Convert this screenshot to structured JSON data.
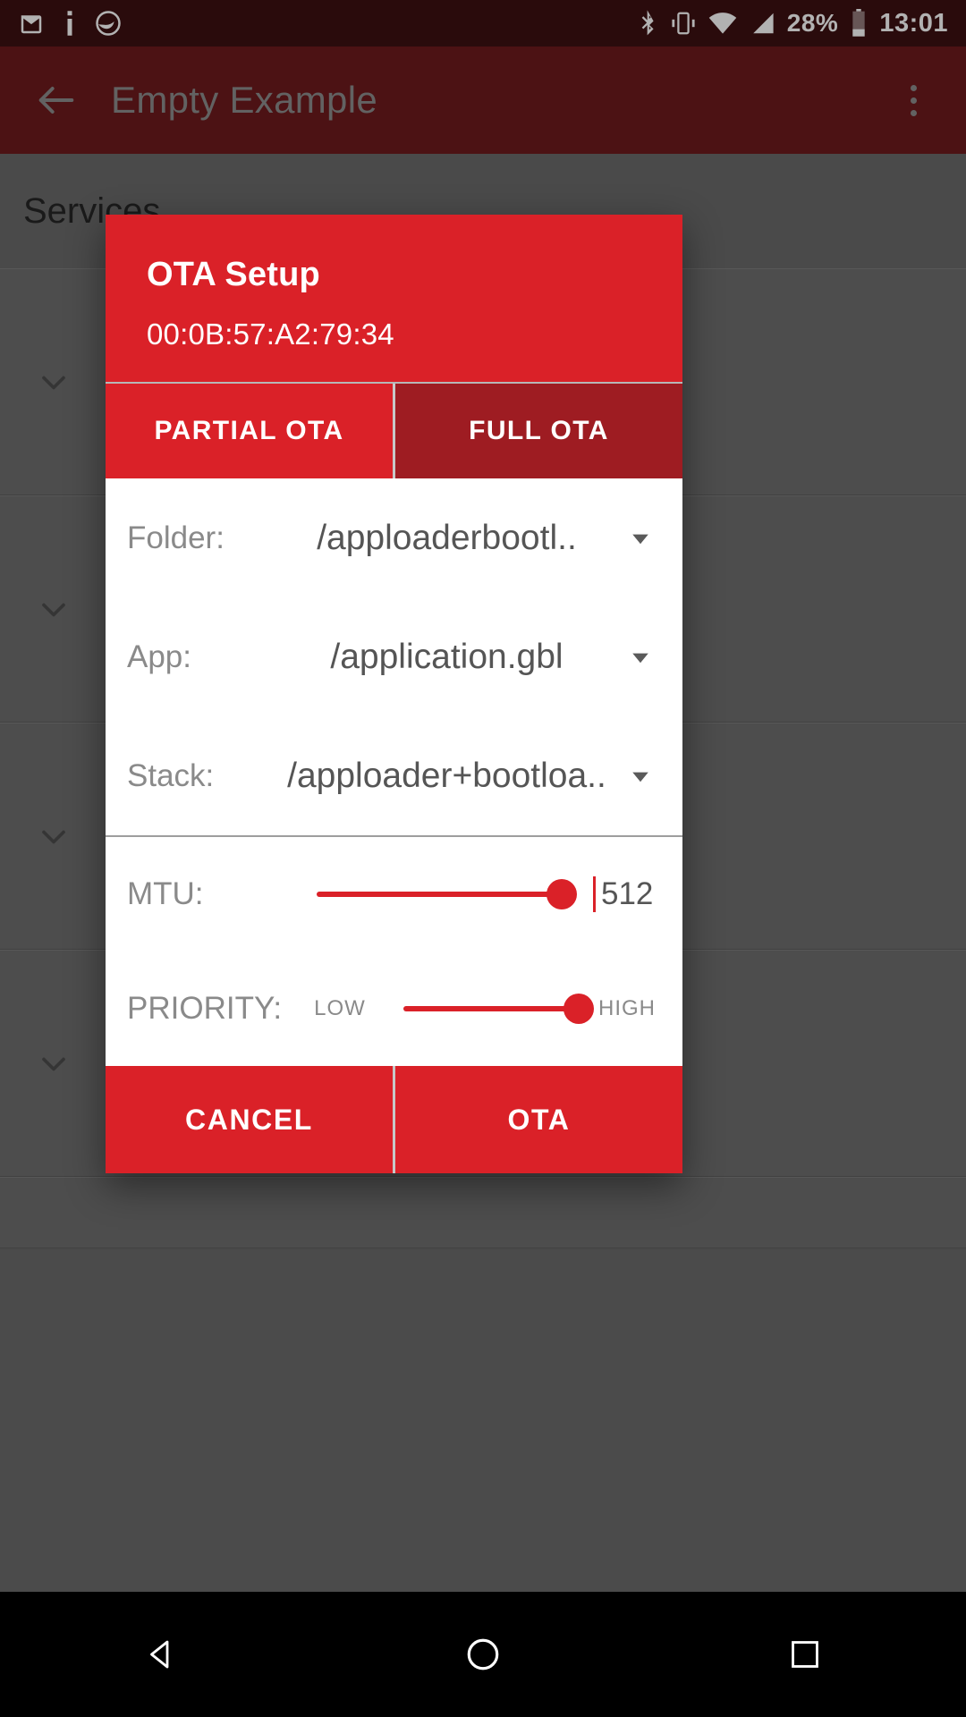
{
  "statusbar": {
    "icons": [
      "gmail-icon",
      "info-icon",
      "circle-app-icon",
      "bluetooth-icon",
      "vibrate-icon",
      "wifi-icon",
      "signal-icon"
    ],
    "battery_percent": "28%",
    "clock": "13:01"
  },
  "appbar": {
    "back_label": "back",
    "title": "Empty Example",
    "overflow_label": "more options"
  },
  "page": {
    "section_title": "Services"
  },
  "dialog": {
    "title": "OTA Setup",
    "subtitle": "00:0B:57:A2:79:34",
    "tabs": [
      {
        "label": "PARTIAL OTA",
        "selected": true
      },
      {
        "label": "FULL OTA",
        "selected": false
      }
    ],
    "fields": [
      {
        "label": "Folder:",
        "value": "/apploaderbootl.."
      },
      {
        "label": "App:",
        "value": "/application.gbl"
      },
      {
        "label": "Stack:",
        "value": "/apploader+bootloa.."
      }
    ],
    "mtu": {
      "label": "MTU:",
      "value": "512",
      "percent": 93
    },
    "priority": {
      "label": "PRIORITY:",
      "low_label": "LOW",
      "high_label": "HIGH",
      "percent": 98
    },
    "actions": [
      {
        "label": "CANCEL"
      },
      {
        "label": "OTA"
      }
    ],
    "colors": {
      "accent": "#da2128",
      "tab_unselected": "#9e1c22",
      "appbar": "#6d1a1d",
      "statusbar": "#3d1012"
    }
  },
  "navbar": {
    "back_label": "back",
    "home_label": "home",
    "recents_label": "recents"
  }
}
